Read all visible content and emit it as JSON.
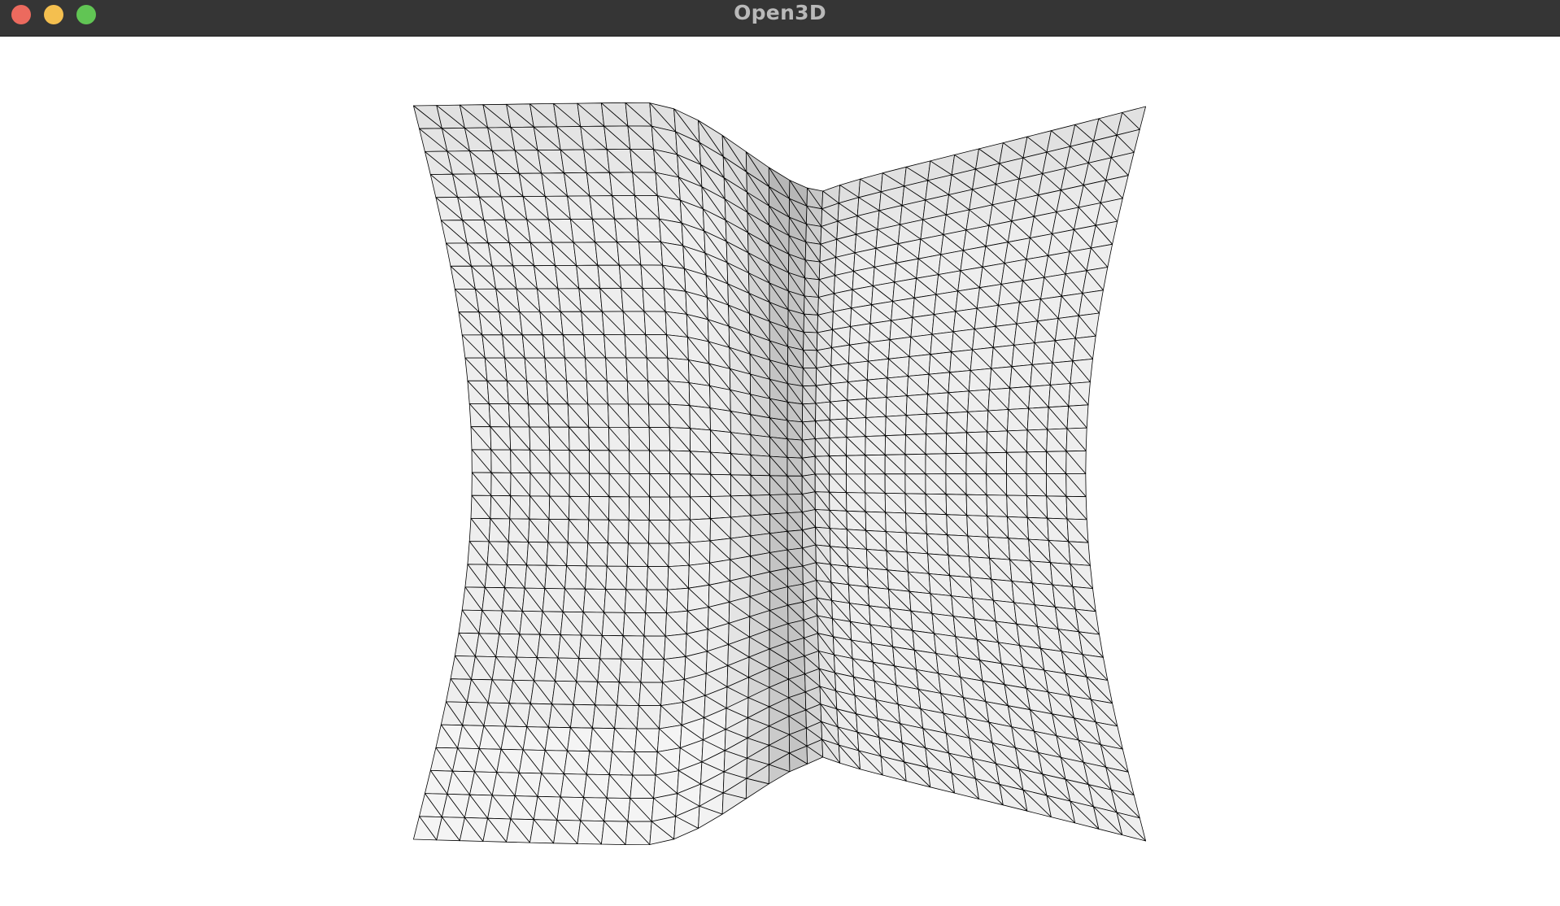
{
  "window": {
    "title": "Open3D",
    "buttons": {
      "close": "close-button",
      "minimize": "minimize-button",
      "zoom": "zoom-button"
    }
  },
  "viewport": {
    "object": "triangle-mesh",
    "grid_rows": 32,
    "grid_cols": 32,
    "background_color": "#ffffff",
    "wireframe_color": "#000000",
    "shading": "gray-lit"
  },
  "colors": {
    "titlebar": "#353535",
    "close": "#ec6a5e",
    "minimize": "#f4bf4f",
    "zoom": "#61c554"
  }
}
